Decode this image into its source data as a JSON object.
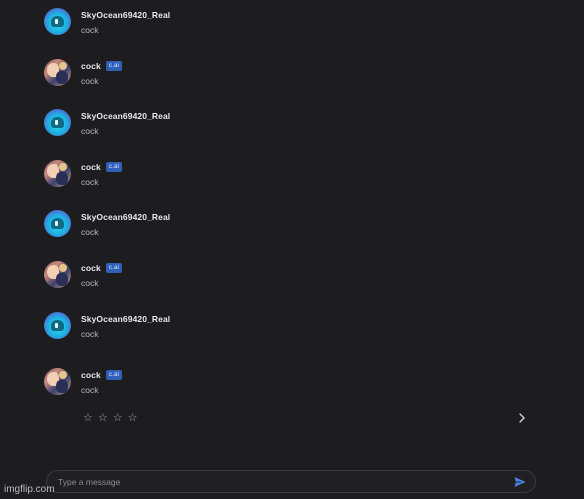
{
  "messages": [
    {
      "role": "user",
      "name": "SkyOcean69420_Real",
      "text": "cock"
    },
    {
      "role": "bot",
      "name": "cock",
      "badge": "c.ai",
      "text": "cock"
    },
    {
      "role": "user",
      "name": "SkyOcean69420_Real",
      "text": "cock"
    },
    {
      "role": "bot",
      "name": "cock",
      "badge": "c.ai",
      "text": "cock"
    },
    {
      "role": "user",
      "name": "SkyOcean69420_Real",
      "text": "cock"
    },
    {
      "role": "bot",
      "name": "cock",
      "badge": "c.ai",
      "text": "cock"
    },
    {
      "role": "user",
      "name": "SkyOcean69420_Real",
      "text": "cock"
    },
    {
      "role": "bot",
      "name": "cock",
      "badge": "c.ai",
      "text": "cock"
    }
  ],
  "rating": {
    "stars": [
      "☆",
      "☆",
      "☆",
      "☆"
    ]
  },
  "composer": {
    "placeholder": "Type a message"
  },
  "watermark": "imgflip.com",
  "colors": {
    "badge": "#2f5fb8",
    "send": "#4a86e8",
    "background": "#1d1d1f"
  }
}
